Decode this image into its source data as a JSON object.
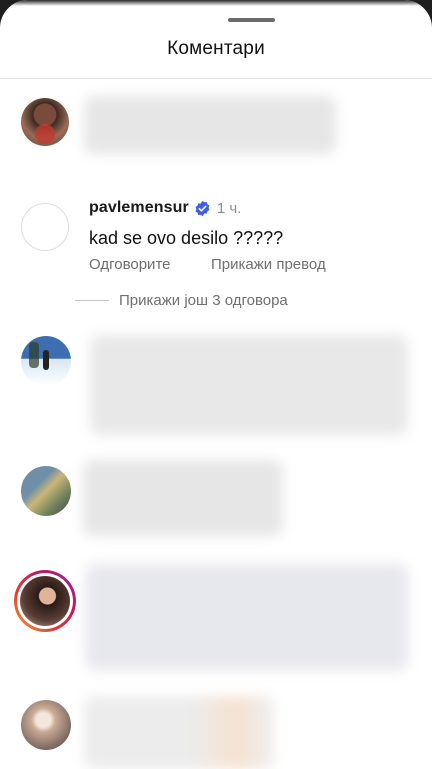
{
  "sheet": {
    "title": "Коментари"
  },
  "comment": {
    "username": "pavlemensur",
    "time": "1 ч.",
    "text": "kad se ovo desilo ?????",
    "reply_label": "Одговорите",
    "translate_label": "Прикажи превод",
    "view_replies_label": "Прикажи још 3 одговора",
    "verified_icon": "verified-badge-icon"
  },
  "colors": {
    "verified": "#3f5ee8",
    "story_ring_start": "#f9a825",
    "story_ring_end": "#c2185b"
  }
}
